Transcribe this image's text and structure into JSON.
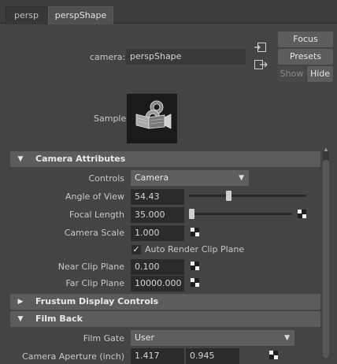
{
  "tabs": [
    {
      "label": "persp",
      "active": false
    },
    {
      "label": "perspShape",
      "active": true
    }
  ],
  "header": {
    "camera_label": "camera:",
    "camera_value": "perspShape",
    "focus_label": "Focus",
    "presets_label": "Presets",
    "show_label": "Show",
    "hide_label": "Hide",
    "sample_label": "Sample"
  },
  "sections": {
    "camera_attributes": "Camera Attributes",
    "frustum": "Frustum Display Controls",
    "film_back": "Film Back"
  },
  "camera_attributes": {
    "controls_label": "Controls",
    "controls_value": "Camera",
    "angle_label": "Angle of View",
    "angle_value": "54.43",
    "angle_slider_fraction": 0.33,
    "focal_label": "Focal Length",
    "focal_value": "35.000",
    "focal_slider_fraction": 0.0,
    "scale_label": "Camera Scale",
    "scale_value": "1.000",
    "auto_clip_label": "Auto Render Clip Plane",
    "auto_clip_checked": true,
    "near_label": "Near Clip Plane",
    "near_value": "0.100",
    "far_label": "Far Clip Plane",
    "far_value": "10000.000"
  },
  "film_back": {
    "gate_label": "Film Gate",
    "gate_value": "User",
    "aperture_label": "Camera Aperture (inch)",
    "aperture_value_1": "1.417",
    "aperture_value_2": "0.945"
  },
  "colors": {
    "background": "#444444",
    "field": "#2b2b2b",
    "section_header": "#5c5c5c",
    "button": "#5d5d5d"
  }
}
